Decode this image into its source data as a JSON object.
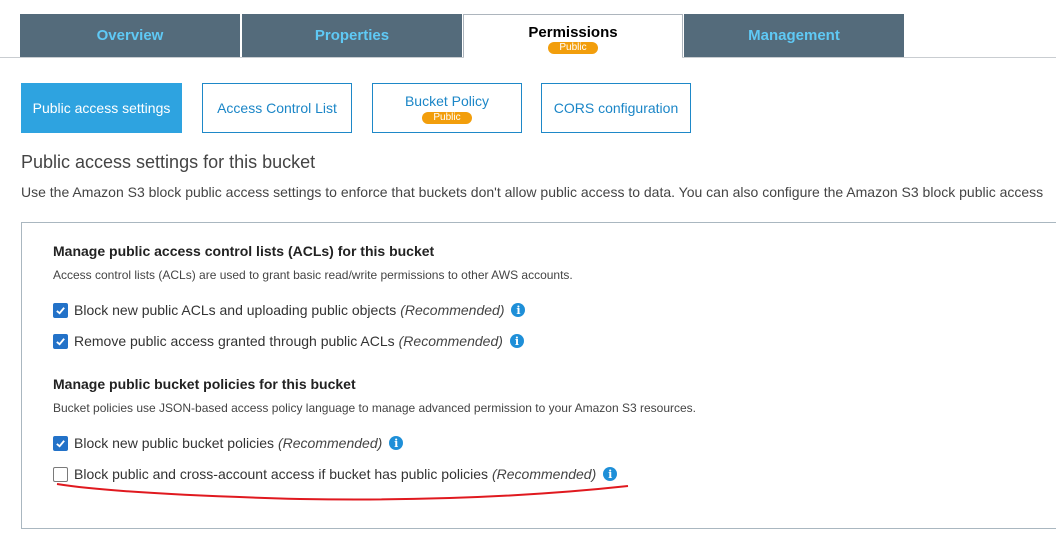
{
  "tabs": [
    {
      "label": "Overview"
    },
    {
      "label": "Properties"
    },
    {
      "label": "Permissions",
      "badge": "Public",
      "active": true
    },
    {
      "label": "Management"
    }
  ],
  "subtabs": [
    {
      "label": "Public access settings",
      "active": true
    },
    {
      "label": "Access Control List"
    },
    {
      "label": "Bucket Policy",
      "badge": "Public"
    },
    {
      "label": "CORS configuration"
    }
  ],
  "section": {
    "title": "Public access settings for this bucket",
    "description": "Use the Amazon S3 block public access settings to enforce that buckets don't allow public access to data. You can also configure the Amazon S3 block public access"
  },
  "acl_group": {
    "title": "Manage public access control lists (ACLs) for this bucket",
    "description": "Access control lists (ACLs) are used to grant basic read/write permissions to other AWS accounts.",
    "options": [
      {
        "label": "Block new public ACLs and uploading public objects",
        "note": "(Recommended)",
        "checked": true
      },
      {
        "label": "Remove public access granted through public ACLs",
        "note": "(Recommended)",
        "checked": true
      }
    ]
  },
  "policy_group": {
    "title": "Manage public bucket policies for this bucket",
    "description": "Bucket policies use JSON-based access policy language to manage advanced permission to your Amazon S3 resources.",
    "options": [
      {
        "label": "Block new public bucket policies",
        "note": "(Recommended)",
        "checked": true
      },
      {
        "label": "Block public and cross-account access if bucket has public policies",
        "note": "(Recommended)",
        "checked": false
      }
    ]
  },
  "icons": {
    "info": "info-icon",
    "check": "checkmark-icon"
  },
  "colors": {
    "tab_bg": "#546b7b",
    "tab_text": "#5fc9f5",
    "accent": "#2ea3e0",
    "badge": "#f29e0c",
    "checkbox": "#2372c8",
    "annotation": "#e0191f"
  }
}
